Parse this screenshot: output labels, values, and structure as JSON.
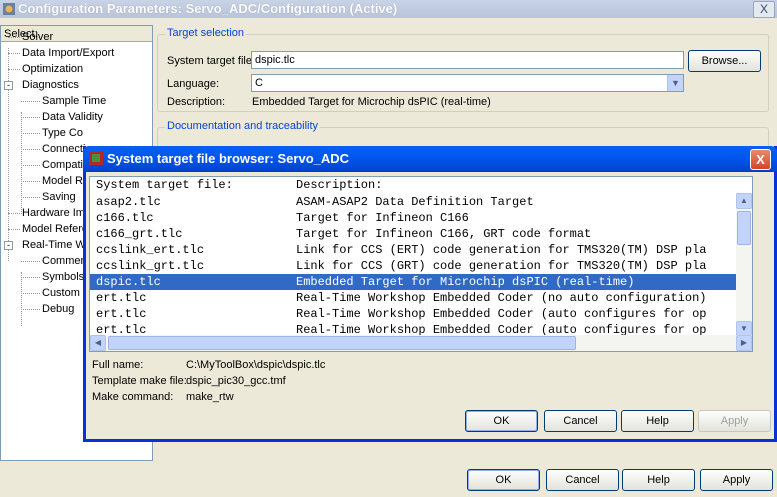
{
  "window": {
    "title": "Configuration Parameters: Servo_ADC/Configuration (Active)",
    "close_glyph": "X"
  },
  "tree": {
    "header": "Select:",
    "items": [
      {
        "label": "Solver"
      },
      {
        "label": "Data Import/Export"
      },
      {
        "label": "Optimization"
      },
      {
        "label": "Diagnostics",
        "expander": "-"
      },
      {
        "label": "Sample Time"
      },
      {
        "label": "Data Validity"
      },
      {
        "label": "Type Co"
      },
      {
        "label": "Connecti"
      },
      {
        "label": "Compatib"
      },
      {
        "label": "Model Re"
      },
      {
        "label": "Saving"
      },
      {
        "label": "Hardware Imp"
      },
      {
        "label": "Model Refere"
      },
      {
        "label": "Real-Time W",
        "expander": "-"
      },
      {
        "label": "Comment"
      },
      {
        "label": "Symbols"
      },
      {
        "label": "Custom C"
      },
      {
        "label": "Debug"
      }
    ]
  },
  "target_selection": {
    "group_title": "Target selection",
    "system_target_label": "System target file:",
    "system_target_value": "dspic.tlc",
    "browse_button": "Browse...",
    "language_label": "Language:",
    "language_value": "C",
    "description_label": "Description:",
    "description_value": "Embedded Target for Microchip dsPIC (real-time)"
  },
  "documentation": {
    "group_title": "Documentation and traceability"
  },
  "dialog": {
    "title": "System target file browser: Servo_ADC",
    "close_glyph": "X",
    "list_header": {
      "file": "System target file:",
      "description": "Description:"
    },
    "rows": [
      {
        "file": "asap2.tlc",
        "description": "ASAM-ASAP2 Data Definition Target"
      },
      {
        "file": "c166.tlc",
        "description": "Target for Infineon C166"
      },
      {
        "file": "c166_grt.tlc",
        "description": "Target for Infineon C166, GRT code format"
      },
      {
        "file": "ccslink_ert.tlc",
        "description": "Link for CCS (ERT) code generation for TMS320(TM) DSP pla"
      },
      {
        "file": "ccslink_grt.tlc",
        "description": "Link for CCS (GRT) code generation for TMS320(TM) DSP pla"
      },
      {
        "file": "dspic.tlc",
        "description": "Embedded Target for Microchip dsPIC (real-time)",
        "selected": true
      },
      {
        "file": "ert.tlc",
        "description": "Real-Time Workshop Embedded Coder (no auto configuration)"
      },
      {
        "file": "ert.tlc",
        "description": "Real-Time Workshop Embedded Coder (auto configures for op"
      },
      {
        "file": "ert.tlc",
        "description": "Real-Time Workshop Embedded Coder (auto configures for op"
      }
    ],
    "full_name_label": "Full name:",
    "full_name_value": "C:\\MyToolBox\\dspic\\dspic.tlc",
    "template_label": "Template make file:",
    "template_value": "dspic_pic30_gcc.tmf",
    "make_label": "Make command:",
    "make_value": "make_rtw",
    "buttons": {
      "ok": "OK",
      "cancel": "Cancel",
      "help": "Help",
      "apply": "Apply"
    }
  },
  "main_buttons": {
    "ok": "OK",
    "cancel": "Cancel",
    "help": "Help",
    "apply": "Apply"
  },
  "colors": {
    "selection": "#316ac5",
    "dialog_title": "#0058ee",
    "group_title": "#0046d5"
  }
}
